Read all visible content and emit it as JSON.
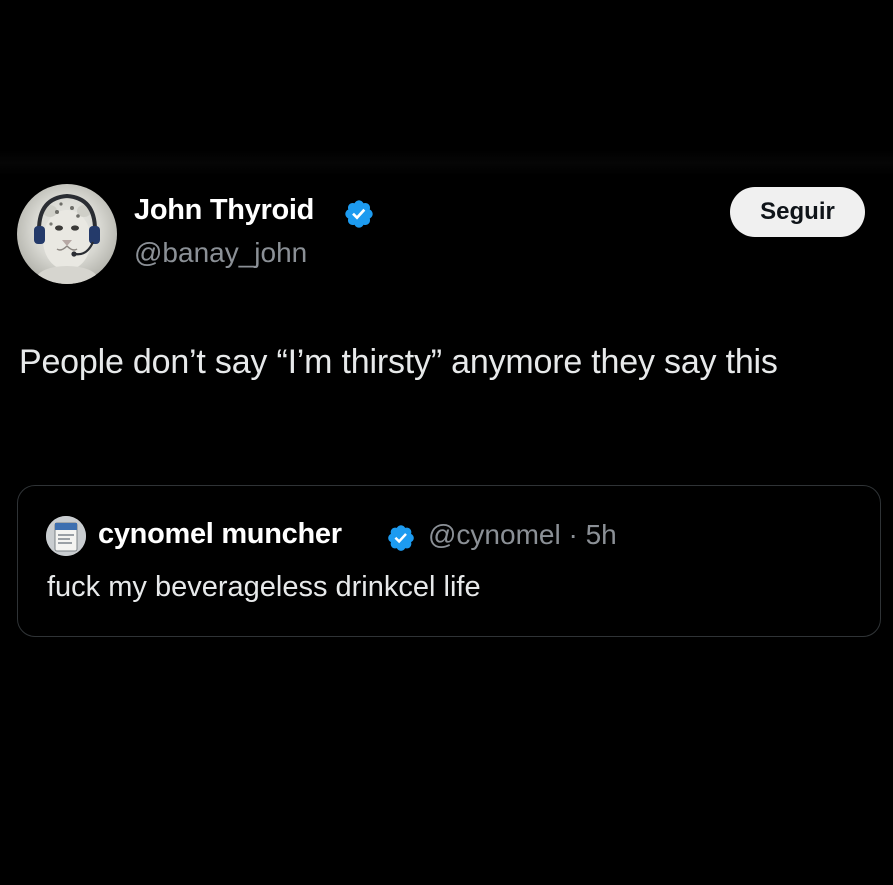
{
  "tweet": {
    "author": {
      "display_name": "John Thyroid",
      "handle": "@banay_john",
      "verified": true,
      "avatar_icon": "snow-leopard-with-headset-avatar"
    },
    "follow_button_label": "Seguir",
    "text": "People don’t say “I’m thirsty” anymore they say this",
    "quoted_tweet": {
      "display_name": "cynomel muncher",
      "verified": true,
      "meta": "@cynomel · 5h",
      "text": "fuck my beverageless drinkcel life",
      "avatar_icon": "medicine-box-avatar"
    }
  },
  "colors": {
    "background": "#000000",
    "primary_text": "#e7e9ea",
    "secondary_text": "#8b9096",
    "verified_badge": "#1d9bf0",
    "follow_button_bg": "#f0f0f0",
    "quote_border": "#2f3336"
  }
}
